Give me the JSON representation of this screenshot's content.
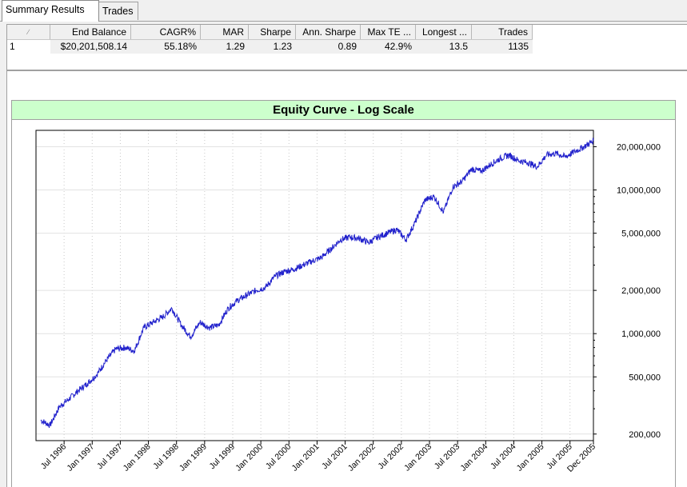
{
  "tabs": [
    {
      "label": "Summary Results",
      "active": true
    },
    {
      "label": "Trades",
      "active": false
    }
  ],
  "results_table": {
    "sort_indicator": "∕",
    "columns": [
      "End Balance",
      "CAGR%",
      "MAR",
      "Sharpe",
      "Ann. Sharpe",
      "Max TE ...",
      "Longest ...",
      "Trades"
    ],
    "rows": [
      {
        "id": "1",
        "values": [
          "$20,201,508.14",
          "55.18%",
          "1.29",
          "1.23",
          "0.89",
          "42.9%",
          "13.5",
          "1135"
        ]
      }
    ]
  },
  "chart_data": {
    "type": "line",
    "title": "Equity Curve - Log Scale",
    "y_scale": "log",
    "ylim": [
      180000,
      26000000
    ],
    "y_ticks": [
      200000,
      500000,
      1000000,
      2000000,
      5000000,
      10000000,
      20000000
    ],
    "y_tick_labels": [
      "200,000",
      "500,000",
      "1,000,000",
      "2,000,000",
      "5,000,000",
      "10,000,000",
      "20,000,000"
    ],
    "x_tick_labels": [
      "Jul 1996",
      "Jan 1997",
      "Jul 1997",
      "Jan 1998",
      "Jul 1998",
      "Jan 1999",
      "Jul 1999",
      "Jan 2000",
      "Jul 2000",
      "Jan 2001",
      "Jul 2001",
      "Jan 2002",
      "Jul 2002",
      "Jan 2003",
      "Jul 2003",
      "Jan 2004",
      "Jul 2004",
      "Jan 2005",
      "Jul 2005",
      "Dec 2005"
    ],
    "x_tick_dates": [
      "1996-07",
      "1997-01",
      "1997-07",
      "1998-01",
      "1998-07",
      "1999-01",
      "1999-07",
      "2000-01",
      "2000-07",
      "2001-01",
      "2001-07",
      "2002-01",
      "2002-07",
      "2003-01",
      "2003-07",
      "2004-01",
      "2004-07",
      "2005-01",
      "2005-07",
      "2005-12"
    ],
    "grid": true,
    "line_color": "#2222cc",
    "series": [
      {
        "x": [
          "1996-02",
          "1996-04",
          "1996-06",
          "1996-08",
          "1996-10",
          "1996-12",
          "1997-02",
          "1997-04",
          "1997-06",
          "1997-08",
          "1997-10",
          "1997-12",
          "1998-02",
          "1998-04",
          "1998-06",
          "1998-08",
          "1998-10",
          "1998-12",
          "1999-02",
          "1999-04",
          "1999-06",
          "1999-08",
          "1999-10",
          "1999-12",
          "2000-02",
          "2000-04",
          "2000-06",
          "2000-08",
          "2000-10",
          "2000-12",
          "2001-02",
          "2001-04",
          "2001-06",
          "2001-08",
          "2001-10",
          "2001-12",
          "2002-02",
          "2002-04",
          "2002-06",
          "2002-08",
          "2002-10",
          "2002-12",
          "2003-02",
          "2003-04",
          "2003-06",
          "2003-08",
          "2003-10",
          "2003-12",
          "2004-02",
          "2004-04",
          "2004-06",
          "2004-08",
          "2004-10",
          "2004-12",
          "2005-02",
          "2005-04",
          "2005-06",
          "2005-08",
          "2005-10",
          "2005-12"
        ],
        "y": [
          250000,
          230000,
          310000,
          350000,
          400000,
          450000,
          520000,
          650000,
          780000,
          800000,
          760000,
          1100000,
          1200000,
          1300000,
          1500000,
          1150000,
          950000,
          1200000,
          1100000,
          1150000,
          1500000,
          1700000,
          1850000,
          2000000,
          2100000,
          2500000,
          2700000,
          2800000,
          3000000,
          3200000,
          3400000,
          3900000,
          4500000,
          4700000,
          4600000,
          4300000,
          4700000,
          5000000,
          5300000,
          4500000,
          6000000,
          8500000,
          9000000,
          7000000,
          10500000,
          11500000,
          14000000,
          13500000,
          15000000,
          16500000,
          17500000,
          16000000,
          15500000,
          14500000,
          17500000,
          18000000,
          17000000,
          18500000,
          20000000,
          22000000
        ]
      }
    ]
  }
}
